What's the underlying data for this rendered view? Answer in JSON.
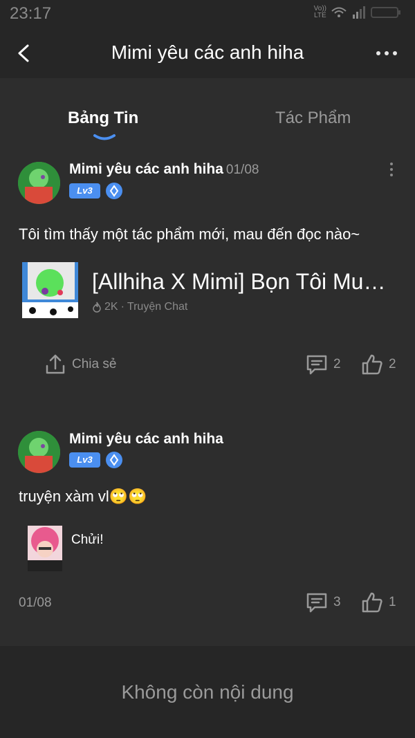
{
  "status_bar": {
    "time": "23:17",
    "volte_top": "Vo))",
    "volte_bottom": "LTE"
  },
  "header": {
    "title": "Mimi yêu các anh hiha",
    "back_icon": "chevron-left-icon",
    "more_icon": "more-horizontal-icon"
  },
  "tabs": [
    {
      "label": "Bảng Tin",
      "active": true
    },
    {
      "label": "Tác Phẩm",
      "active": false
    }
  ],
  "posts": [
    {
      "author": "Mimi yêu các anh hiha",
      "date": "01/08",
      "level": "Lv3",
      "text": "Tôi tìm thấy một tác phẩm mới, mau đến đọc nào~",
      "work": {
        "title": "[Allhiha X Mimi] Bọn Tôi Muốn Làm Người Yêu Của Mimi",
        "views": "2K",
        "separator": "·",
        "type": "Truyện Chat"
      },
      "share_label": "Chia sẻ",
      "comments": "2",
      "likes": "2"
    },
    {
      "author": "Mimi yêu các anh hiha",
      "level": "Lv3",
      "text": "truyện xàm vl🙄🙄",
      "reply_text": "Chửi!",
      "date": "01/08",
      "comments": "3",
      "likes": "1"
    }
  ],
  "footer": {
    "text": "Không còn nội dung"
  },
  "colors": {
    "background": "#2d2d2d",
    "header": "#262626",
    "accent": "#4b8ff0"
  }
}
